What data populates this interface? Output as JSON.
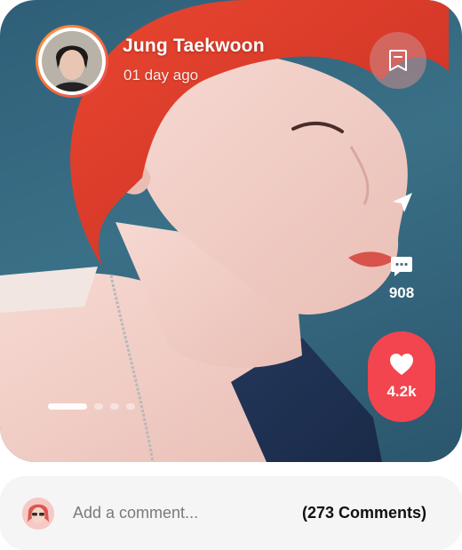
{
  "post": {
    "user_name": "Jung Taekwoon",
    "time_ago": "01 day ago",
    "comment_count": "908",
    "like_count": "4.2k",
    "carousel": {
      "total": 4,
      "active": 0
    }
  },
  "icons": {
    "bookmark": "bookmark-icon",
    "share": "send-icon",
    "comment": "chat-bubble-icon",
    "like": "heart-icon"
  },
  "comment_bar": {
    "placeholder": "Add a comment...",
    "comments_link": "(273 Comments)"
  },
  "colors": {
    "like_background": "#f2454f",
    "avatar_ring_start": "#ff9a3d",
    "avatar_ring_end": "#e84a5f",
    "photo_background": "#3a7087",
    "comment_bar_background": "#f5f5f5"
  }
}
